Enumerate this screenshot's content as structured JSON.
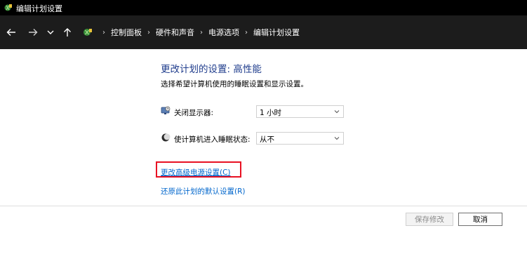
{
  "window": {
    "title": "编辑计划设置"
  },
  "nav": {
    "breadcrumbs": [
      "控制面板",
      "硬件和声音",
      "电源选项",
      "编辑计划设置"
    ],
    "separator": "›",
    "icons": [
      "back-arrow-icon",
      "forward-arrow-icon",
      "recent-locations-chevron-icon",
      "up-arrow-icon",
      "control-panel-icon"
    ]
  },
  "main": {
    "heading": "更改计划的设置: 高性能",
    "subtitle": "选择希望计算机使用的睡眠设置和显示设置。",
    "settings": [
      {
        "label": "关闭显示器:",
        "value": "1 小时",
        "icon": "monitor-icon"
      },
      {
        "label": "使计算机进入睡眠状态:",
        "value": "从不",
        "icon": "sleep-moon-icon"
      }
    ],
    "links": {
      "advanced": "更改高级电源设置(C)",
      "restore": "还原此计划的默认设置(R)"
    },
    "highlight_color": "#e81123"
  },
  "footer": {
    "save_label": "保存修改",
    "cancel_label": "取消"
  }
}
